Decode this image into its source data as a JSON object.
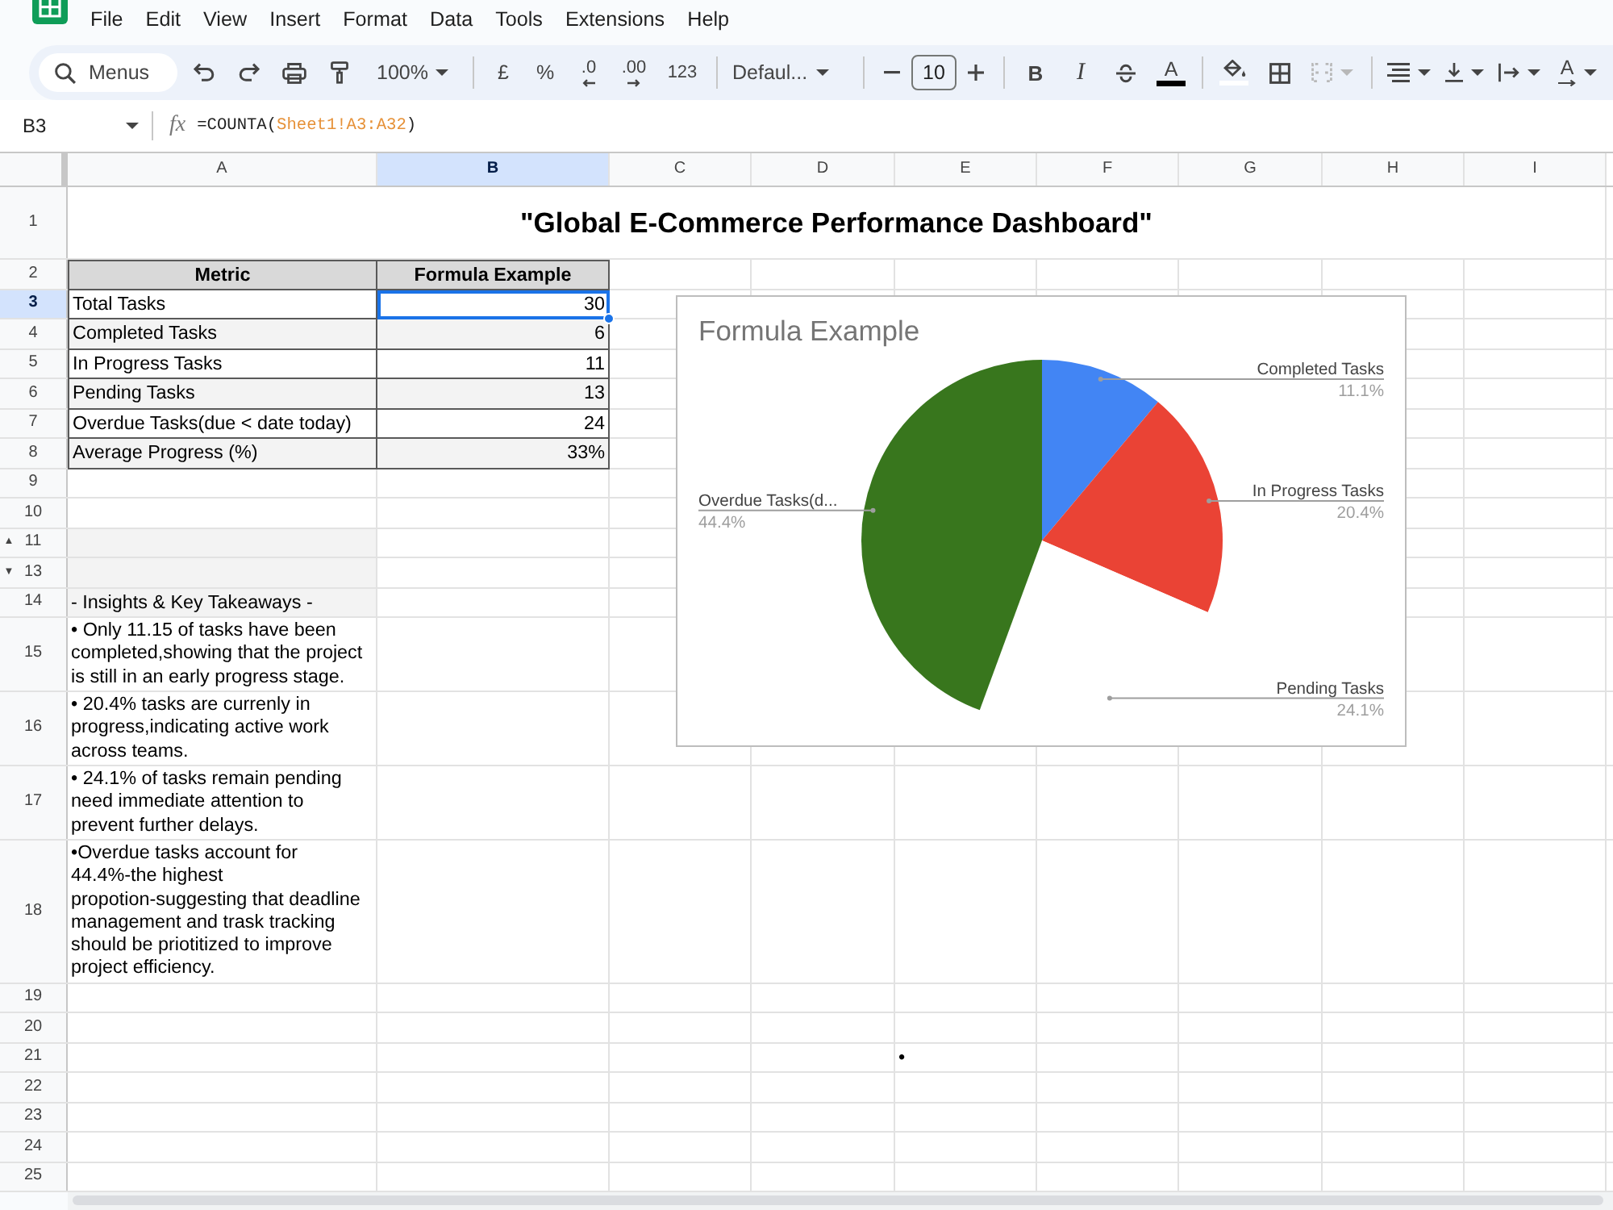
{
  "menu": {
    "items": [
      "File",
      "Edit",
      "View",
      "Insert",
      "Format",
      "Data",
      "Tools",
      "Extensions",
      "Help"
    ]
  },
  "toolbar": {
    "search": {
      "placeholder": "Menus"
    },
    "zoom": "100%",
    "currency": "£",
    "percent": "%",
    "decrease_decimal": ".0",
    "increase_decimal": ".00",
    "number_format": "123",
    "font": "Defaul...",
    "font_size": "10",
    "bold": "B",
    "italic": "I",
    "text_color": "A",
    "merge_cells": {
      "disabled": true
    },
    "text_rotation": "A"
  },
  "formula_bar": {
    "name_box": "B3",
    "fx": "fx",
    "formula": [
      {
        "kind": "plain",
        "text": "=COUNTA("
      },
      {
        "kind": "range",
        "text": "Sheet1!A3:A32"
      },
      {
        "kind": "plain",
        "text": ")"
      }
    ]
  },
  "sheet": {
    "columns": [
      {
        "label": "A",
        "selected": false
      },
      {
        "label": "B",
        "selected": true
      },
      {
        "label": "C",
        "selected": false
      },
      {
        "label": "D",
        "selected": false
      },
      {
        "label": "E",
        "selected": false
      },
      {
        "label": "F",
        "selected": false
      },
      {
        "label": "G",
        "selected": false
      },
      {
        "label": "H",
        "selected": false
      },
      {
        "label": "I",
        "selected": false
      }
    ],
    "rows": [
      {
        "number": "1",
        "selected": false,
        "kind": "title",
        "cells": [
          {
            "text": "\"Global E-Commerce Performance Dashboard\"",
            "selected": false
          }
        ]
      },
      {
        "number": "2",
        "selected": false,
        "kind": "header",
        "cells": [
          {
            "text": "Metric",
            "selected": false
          },
          {
            "text": "Formula Example",
            "selected": false
          }
        ]
      },
      {
        "number": "3",
        "selected": true,
        "kind": "data",
        "cells": [
          {
            "text": "Total Tasks",
            "shaded": false,
            "selected": false
          },
          {
            "text": "30",
            "shaded": false,
            "selected": true
          }
        ]
      },
      {
        "number": "4",
        "selected": false,
        "kind": "data",
        "cells": [
          {
            "text": "Completed Tasks",
            "shaded": true,
            "selected": false
          },
          {
            "text": "6",
            "shaded": true,
            "selected": false
          }
        ]
      },
      {
        "number": "5",
        "selected": false,
        "kind": "data",
        "cells": [
          {
            "text": "In Progress Tasks",
            "shaded": false,
            "selected": false
          },
          {
            "text": "11",
            "shaded": false,
            "selected": false
          }
        ]
      },
      {
        "number": "6",
        "selected": false,
        "kind": "data",
        "cells": [
          {
            "text": "Pending Tasks",
            "shaded": true,
            "selected": false
          },
          {
            "text": "13",
            "shaded": true,
            "selected": false
          }
        ]
      },
      {
        "number": "7",
        "selected": false,
        "kind": "data",
        "cells": [
          {
            "text": "Overdue Tasks(due < date today)",
            "shaded": false,
            "selected": false
          },
          {
            "text": "24",
            "shaded": false,
            "selected": false
          }
        ]
      },
      {
        "number": "8",
        "selected": false,
        "kind": "data",
        "cells": [
          {
            "text": "Average Progress (%)",
            "shaded": true,
            "selected": false
          },
          {
            "text": "33%",
            "shaded": true,
            "selected": false
          }
        ]
      },
      {
        "number": "9",
        "selected": false,
        "kind": "blank"
      },
      {
        "number": "10",
        "selected": false,
        "kind": "blank"
      },
      {
        "number": "11",
        "selected": false,
        "kind": "blank",
        "marker": "▲",
        "cells": [
          {
            "shaded": true,
            "selected": false
          }
        ]
      },
      {
        "number": "13",
        "selected": false,
        "kind": "blank",
        "marker": "▼",
        "cells": [
          {
            "shaded": true,
            "selected": false
          }
        ]
      },
      {
        "number": "14",
        "selected": false,
        "kind": "heading",
        "cells": [
          {
            "text": "- Insights & Key Takeaways -",
            "shaded": true,
            "selected": false
          }
        ]
      },
      {
        "number": "15",
        "selected": false,
        "kind": "note",
        "cells": [
          {
            "text": "• Only 11.15 of tasks have been completed,showing that the project is still in an early progress stage.",
            "shaded": false,
            "selected": false
          }
        ]
      },
      {
        "number": "16",
        "selected": false,
        "kind": "note",
        "cells": [
          {
            "text": "• 20.4% tasks are currenly in progress,indicating active work across teams.",
            "shaded": false,
            "selected": false
          }
        ]
      },
      {
        "number": "17",
        "selected": false,
        "kind": "note",
        "cells": [
          {
            "text": "• 24.1% of tasks remain pending need immediate attention to prevent further delays.",
            "shaded": false,
            "selected": false
          }
        ]
      },
      {
        "number": "18",
        "selected": false,
        "kind": "note",
        "cells": [
          {
            "text": "•Overdue tasks account for 44.4%-the highest propotion-suggesting that deadline management and trask tracking should be priotitized to improve project efficiency.",
            "shaded": false,
            "selected": false
          }
        ]
      },
      {
        "number": "19",
        "selected": false,
        "kind": "blank"
      },
      {
        "number": "20",
        "selected": false,
        "kind": "blank"
      },
      {
        "number": "21",
        "selected": false,
        "kind": "blank",
        "cells": [
          {
            "selected": false
          },
          {
            "selected": false
          },
          {
            "selected": false
          },
          {
            "selected": false
          },
          {
            "text": "•",
            "shaded": false,
            "selected": false
          }
        ]
      },
      {
        "number": "22",
        "selected": false,
        "kind": "blank"
      },
      {
        "number": "23",
        "selected": false,
        "kind": "blank"
      },
      {
        "number": "24",
        "selected": false,
        "kind": "blank"
      },
      {
        "number": "25",
        "selected": false,
        "kind": "blank"
      }
    ]
  },
  "chart": {
    "chart_data": {
      "type": "pie",
      "title": "Formula Example",
      "categories": [
        "Completed Tasks",
        "In Progress Tasks",
        "Pending Tasks",
        "Overdue Tasks(d..."
      ],
      "values": [
        11.1,
        20.4,
        24.1,
        44.4
      ],
      "value_labels": [
        "11.1%",
        "20.4%",
        "24.1%",
        "44.4%"
      ],
      "colors": [
        "#4285f4",
        "#ea4335",
        "#ffffff",
        "#38761d"
      ]
    }
  }
}
